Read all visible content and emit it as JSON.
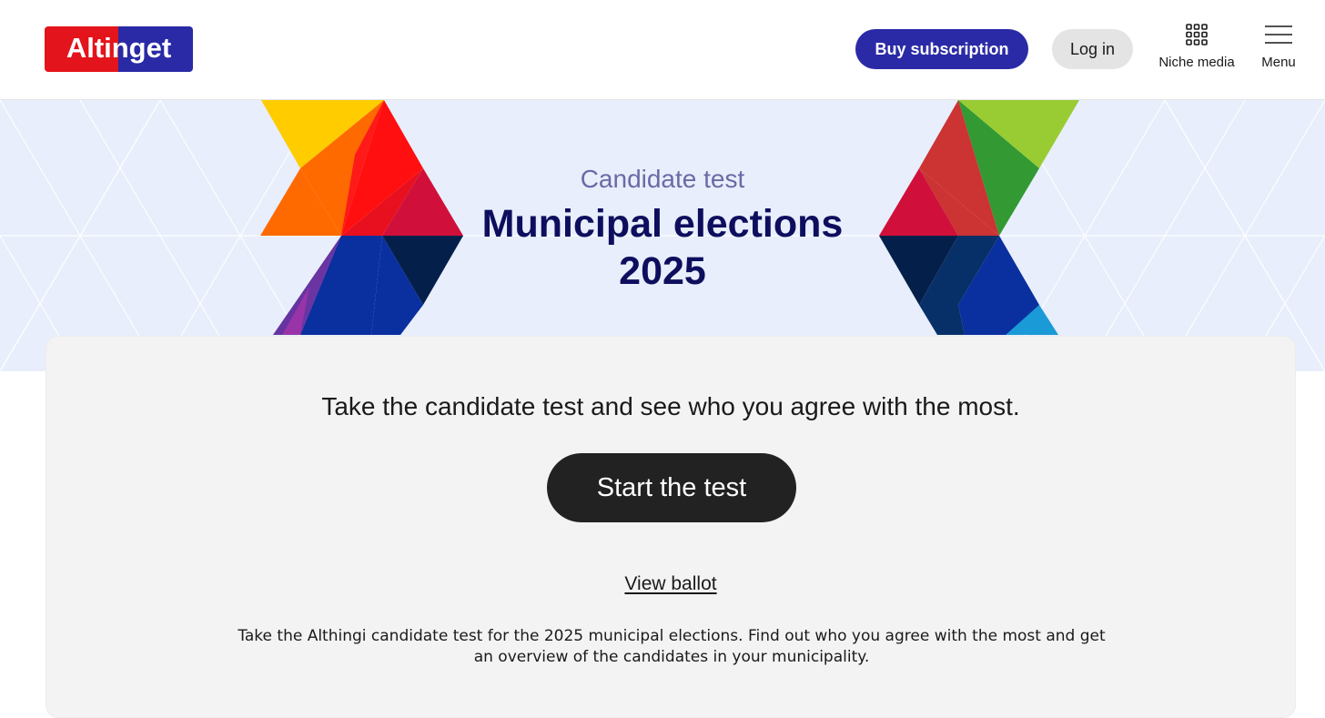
{
  "header": {
    "logo_text": "Altinget",
    "buy_subscription": "Buy subscription",
    "log_in": "Log in",
    "niche_media": {
      "label": "Niche media",
      "icon": "grid-icon"
    },
    "menu": {
      "label": "Menu",
      "icon": "hamburger-icon"
    }
  },
  "hero": {
    "kicker": "Candidate test",
    "title_line1": "Municipal elections",
    "title_line2": "2025"
  },
  "card": {
    "lead": "Take the candidate test and see who you agree with the most.",
    "start_button": "Start the test",
    "view_ballot": "View ballot",
    "description": "Take the Althingi candidate test for the 2025 municipal elections. Find out who you agree with the most and get an overview of the candidates in your municipality."
  },
  "colors": {
    "brand_red": "#e3141b",
    "brand_blue": "#2a2aa6",
    "hero_background": "#e8eefb",
    "title_navy": "#0e0e5e",
    "start_button": "#222222"
  }
}
